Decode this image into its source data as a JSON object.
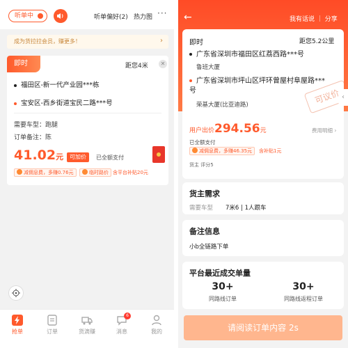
{
  "left": {
    "listen_label": "听单中",
    "pref_label": "听单偏好(2)",
    "hot_label": "热力图",
    "more_label": "···",
    "promo_text": "成为货拉拉会员，赚更多！",
    "promo_arrow": "›",
    "order": {
      "tag": "即时",
      "distance": "距您4米",
      "close": "✕",
      "from": "福田区-新一代产业园***栋",
      "to": "宝安区-西乡街道宝民二路***号",
      "vehicle_label": "需要车型：",
      "vehicle_value": "跑腿",
      "note_label": "订单备注：",
      "note_value": "陈",
      "price_int": "41.02",
      "price_unit": "元",
      "add_price": "可加价",
      "paid": "已全额支付",
      "tag1": "减佣息费，多赚0.76元",
      "tag2": "临时路价",
      "tag3": "含平台补贴20元"
    },
    "tabs": [
      {
        "label": "抢单",
        "badge": ""
      },
      {
        "label": "订单",
        "badge": ""
      },
      {
        "label": "货滴赚",
        "badge": ""
      },
      {
        "label": "消息",
        "badge": "6"
      },
      {
        "label": "我的",
        "badge": ""
      }
    ],
    "accent": "#ff5a2c"
  },
  "right": {
    "back": "←",
    "links": "我有话说 ｜ 分享",
    "imm": "即时",
    "distance": "距您5.2公里",
    "from": "广东省深圳市福田区红荔西路***号",
    "from_sub": "鲁班大厦",
    "to": "广东省深圳市坪山区坪环曾屋村阜屋路***号",
    "to_sub": "荣基大厦(比亚迪路)",
    "stamp": "可议价",
    "side_arrow": "‹",
    "price_prefix": "用户出价",
    "price": "294.56",
    "price_unit": "元",
    "fee_link": "费用明细 ›",
    "paid": "已全额支付",
    "tag1": "减佣息费，多赚46.35元",
    "sub2": "含补贴1元",
    "owner": "货主  评分5",
    "cargo": {
      "title": "货主需求",
      "k": "需要车型",
      "v": "7米6 | 1人跟车"
    },
    "note": {
      "title": "备注信息",
      "v": "小b全链路下单"
    },
    "volume": {
      "title": "平台最近成交单量",
      "stat1_n": "30+",
      "stat1_d": "同路线订单",
      "stat2_n": "30+",
      "stat2_d": "同路线返程订单"
    },
    "bottom_btn": "请阅读订单内容 2s"
  }
}
